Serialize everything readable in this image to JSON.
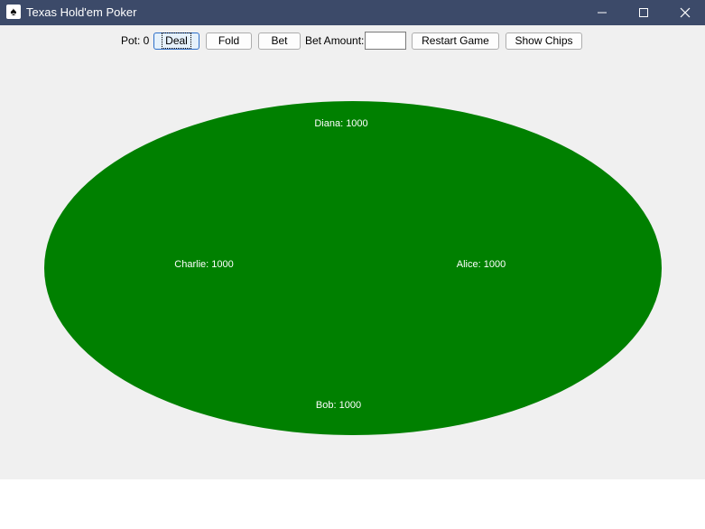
{
  "window": {
    "title": "Texas Hold'em Poker",
    "icon": "poker-cards-icon"
  },
  "toolbar": {
    "pot_label": "Pot: 0",
    "deal_label": "Deal",
    "fold_label": "Fold",
    "bet_label": "Bet",
    "bet_amount_label": "Bet Amount:",
    "bet_amount_value": "",
    "restart_label": "Restart Game",
    "show_chips_label": "Show Chips"
  },
  "table": {
    "felt_color": "#008000",
    "players": {
      "top": "Diana: 1000",
      "left": "Charlie: 1000",
      "right": "Alice: 1000",
      "bottom": "Bob: 1000"
    }
  }
}
